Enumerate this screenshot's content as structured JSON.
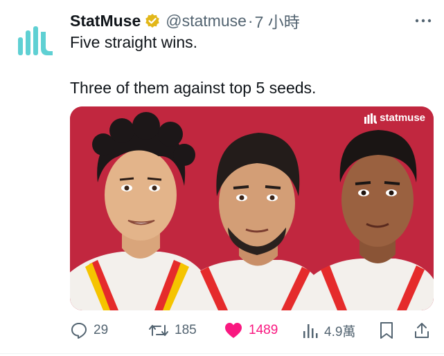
{
  "tweet": {
    "author_name": "StatMuse",
    "handle": "@statmuse",
    "separator": "·",
    "time": "7 小時",
    "lines": [
      "Five straight wins.",
      "Three of them against top 5 seeds."
    ]
  },
  "media": {
    "watermark": "statmuse",
    "background_color": "#c1273f"
  },
  "actions": {
    "replies": "29",
    "retweets": "185",
    "likes": "1489",
    "views": "4.9萬"
  },
  "colors": {
    "brand_teal": "#5fd0d3",
    "verified_gold": "#e2b719",
    "like_pink": "#f91880",
    "secondary_text": "#536471"
  },
  "icons": [
    "statmuse-logo-icon",
    "verified-badge-icon",
    "more-icon",
    "reply-icon",
    "retweet-icon",
    "like-icon",
    "views-icon",
    "bookmark-icon",
    "share-icon"
  ]
}
